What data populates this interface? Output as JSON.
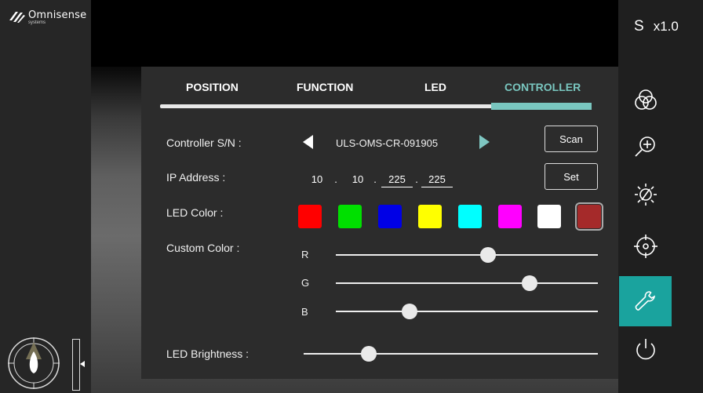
{
  "app": {
    "logo_name": "Omnisense",
    "logo_sub": "systems"
  },
  "header": {
    "mode_letter": "S",
    "zoom": "x1.0"
  },
  "tabs": [
    {
      "label": "POSITION",
      "active": false
    },
    {
      "label": "FUNCTION",
      "active": false
    },
    {
      "label": "LED",
      "active": false
    },
    {
      "label": "CONTROLLER",
      "active": true
    }
  ],
  "controller": {
    "sn_label": "Controller S/N :",
    "sn_value": "ULS-OMS-CR-091905",
    "scan_label": "Scan",
    "ip_label": "IP Address :",
    "ip": [
      "10",
      "10",
      "225",
      "225"
    ],
    "ip_separator": ".",
    "set_label": "Set",
    "led_color_label": "LED Color :",
    "led_colors": [
      "#ff0000",
      "#00e000",
      "#0000e6",
      "#ffff00",
      "#00ffff",
      "#ff00ff",
      "#ffffff",
      "#a52a2a"
    ],
    "selected_color_index": 7,
    "custom_color_label": "Custom Color :",
    "custom_color": [
      {
        "channel": "R",
        "value": 0.58
      },
      {
        "channel": "G",
        "value": 0.74
      },
      {
        "channel": "B",
        "value": 0.28
      }
    ],
    "brightness_label": "LED Brightness :",
    "brightness": 0.22
  },
  "sidebar": {
    "icons": [
      "color-mix-icon",
      "zoom-in-icon",
      "brightness-icon",
      "target-icon",
      "wrench-icon",
      "power-icon"
    ],
    "active_icon": "wrench-icon"
  },
  "colors": {
    "accent": "#79c6bf",
    "active_tile": "#1aa39e",
    "panel": "#2c2c2c"
  }
}
